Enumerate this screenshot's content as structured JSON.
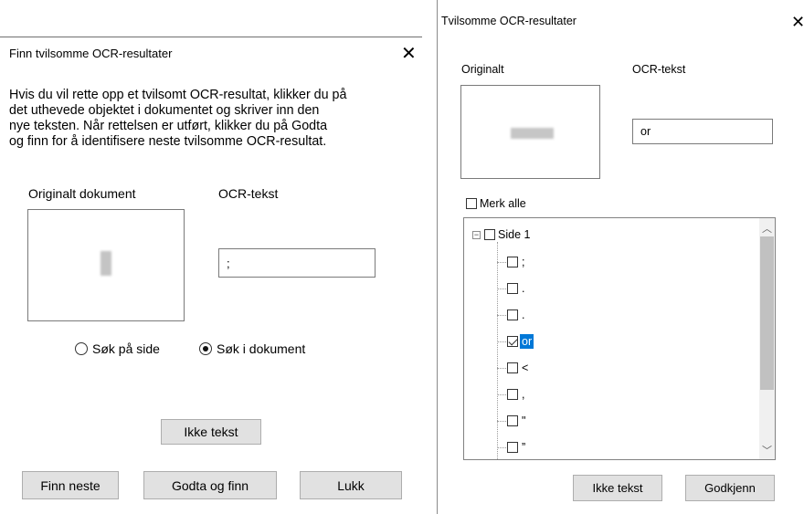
{
  "left_dialog": {
    "title": "Finn tvilsomme OCR-resultater",
    "instruction_lines": [
      "Hvis du vil rette opp et tvilsomt OCR-resultat, klikker du på",
      "det uthevede objektet i dokumentet og skriver inn den",
      "nye teksten. Når rettelsen er utført, klikker du på Godta",
      "og finn for å identifisere neste tvilsomme OCR-resultat."
    ],
    "original_label": "Originalt dokument",
    "ocr_label": "OCR-tekst",
    "ocr_value": ";",
    "search_page_label": "Søk på side",
    "search_document_label": "Søk i dokument",
    "selected_search": "document",
    "not_text_button": "Ikke tekst",
    "find_next_button": "Finn neste",
    "accept_find_button": "Godta og finn",
    "close_button": "Lukk"
  },
  "right_dialog": {
    "title": "Tvilsomme OCR-resultater",
    "original_label": "Originalt",
    "ocr_label": "OCR-tekst",
    "ocr_value": "or",
    "select_all_label": "Merk alle",
    "tree_root_label": "Side 1",
    "tree_items": [
      {
        "text": ";",
        "checked": false,
        "selected": false
      },
      {
        "text": ".",
        "checked": false,
        "selected": false
      },
      {
        "text": ".",
        "checked": false,
        "selected": false
      },
      {
        "text": "or",
        "checked": true,
        "selected": true
      },
      {
        "text": "<",
        "checked": false,
        "selected": false
      },
      {
        "text": ",",
        "checked": false,
        "selected": false
      },
      {
        "text": "\"",
        "checked": false,
        "selected": false
      },
      {
        "text": "”",
        "checked": false,
        "selected": false
      },
      {
        "text": "\"",
        "checked": false,
        "selected": false
      }
    ],
    "not_text_button": "Ikke tekst",
    "approve_button": "Godkjenn"
  },
  "colors": {
    "selection": "#0078d7",
    "button_face": "#e1e1e1",
    "button_border": "#adadad"
  },
  "icons": {
    "close": "close-icon",
    "scroll_up": "chevron-up-icon",
    "scroll_down": "chevron-down-icon",
    "tree_collapse": "minus-box-icon"
  }
}
